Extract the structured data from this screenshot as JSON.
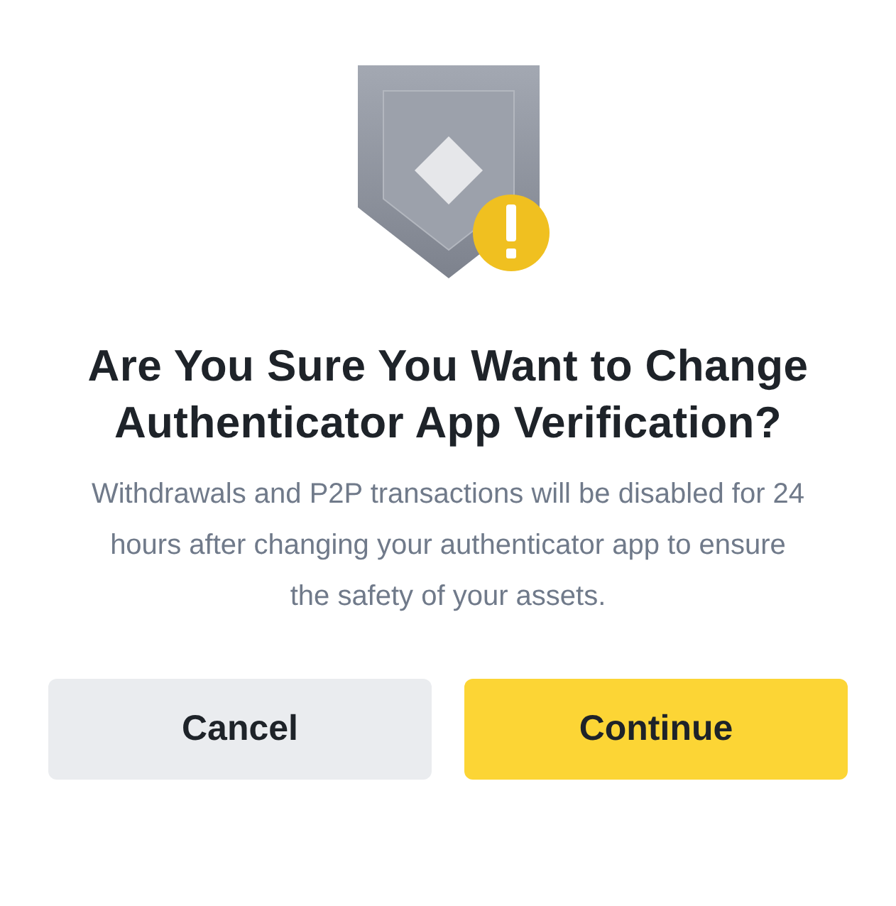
{
  "dialog": {
    "title": "Are You Sure You Want to Change Authenticator App Verification?",
    "message": "Withdrawals and P2P transactions will be disabled for 24 hours after changing your authenticator app to ensure the safety of your assets.",
    "buttons": [
      {
        "label": "Cancel",
        "kind": "secondary"
      },
      {
        "label": "Continue",
        "kind": "primary"
      }
    ]
  }
}
